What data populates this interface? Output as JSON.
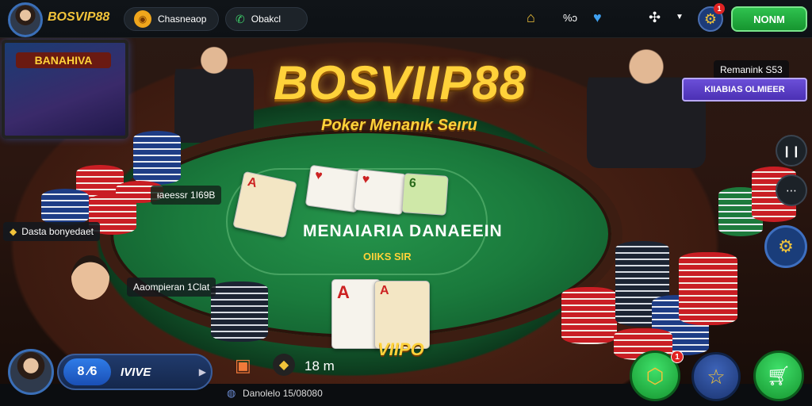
{
  "header": {
    "brand": "BOSVIP88",
    "pill_left": "Chasneaop",
    "pill_right": "Obakcl",
    "count_label": "%ɔ",
    "notif_badge": "1",
    "action_button": "NONM"
  },
  "hero": {
    "logo": "BOSVIIP88",
    "tagline": "Poker Menanık Seıru"
  },
  "tv": {
    "title": "BANAHIVA"
  },
  "right_panel": {
    "remaining": "Remanink S53",
    "banner": "KIIABIAS OLMIEER"
  },
  "table": {
    "center_title": "MENAIARIA DANAEEIN",
    "center_sub": "OIIKS SIR",
    "pot_label": "ᵻaeessr 1I69B",
    "player_left": "Dasta bonyedaet",
    "player_bottom": "Ааomрieran 1Сlat",
    "hand_badge": "VIIPO"
  },
  "footer": {
    "level": "8 ⁄6",
    "mode": "IVIVE",
    "timer": "18 m",
    "status": "Danolelo 15/08080",
    "notif_badge": "1"
  },
  "colors": {
    "accent_gold": "#ffd23a",
    "felt_green": "#1a7a3c",
    "button_green": "#2fc24f",
    "banner_purple": "#5b3fc4"
  }
}
